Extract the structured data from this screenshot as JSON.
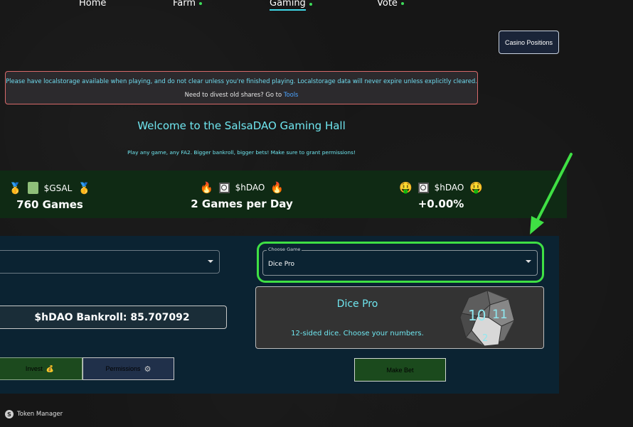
{
  "nav": {
    "home": "Home",
    "farm": "Farm",
    "gaming": "Gaming",
    "vote": "Vote",
    "active_color": "#3fd8e8",
    "dot_color": "#3ddc5a"
  },
  "casino_positions_label": "Casino Positions",
  "warning": {
    "line1": "Please have localstorage available when playing, and do not clear unless you're finished playing. Localstorage data will never expire unless explicitly cleared.",
    "line2_prefix": "Need to divest old shares? Go to",
    "tools_link": "Tools"
  },
  "welcome_title": "Welcome to the SalsaDAO Gaming Hall",
  "subtitle": "Play any game, any FA2. Bigger bankroll, bigger bets! Make sure to grant permissions!",
  "stats": [
    {
      "left_emoji": "🥇",
      "token": "$GSAL",
      "right_emoji": "🥇",
      "value": "760 Games"
    },
    {
      "left_emoji": "🔥",
      "token": "$hDAO",
      "right_emoji": "🔥",
      "value": "2 Games per Day"
    },
    {
      "left_emoji": "🤑",
      "token": "$hDAO",
      "right_emoji": "🤑",
      "value": "+0.00%"
    }
  ],
  "bankroll_label": "$hDAO Bankroll: 85.707092",
  "invest_label": "Invest",
  "invest_emoji": "💰",
  "permissions_label": "Permissions",
  "permissions_icon": "⚙",
  "game_select": {
    "legend": "Choose Game",
    "value": "Dice Pro"
  },
  "game_card": {
    "title": "Dice Pro",
    "description": "12-sided dice. Choose your numbers.",
    "dice_faces": [
      "10",
      "11",
      "2"
    ]
  },
  "make_bet_label": "Make Bet",
  "token_manager_label": "Token Manager",
  "token_manager_icon": "S",
  "colors": {
    "accent_cyan": "#6fe6ef",
    "highlight_green": "#3fe044",
    "panel_bg": "#0b2332",
    "stats_bg": "#0f2a14"
  }
}
